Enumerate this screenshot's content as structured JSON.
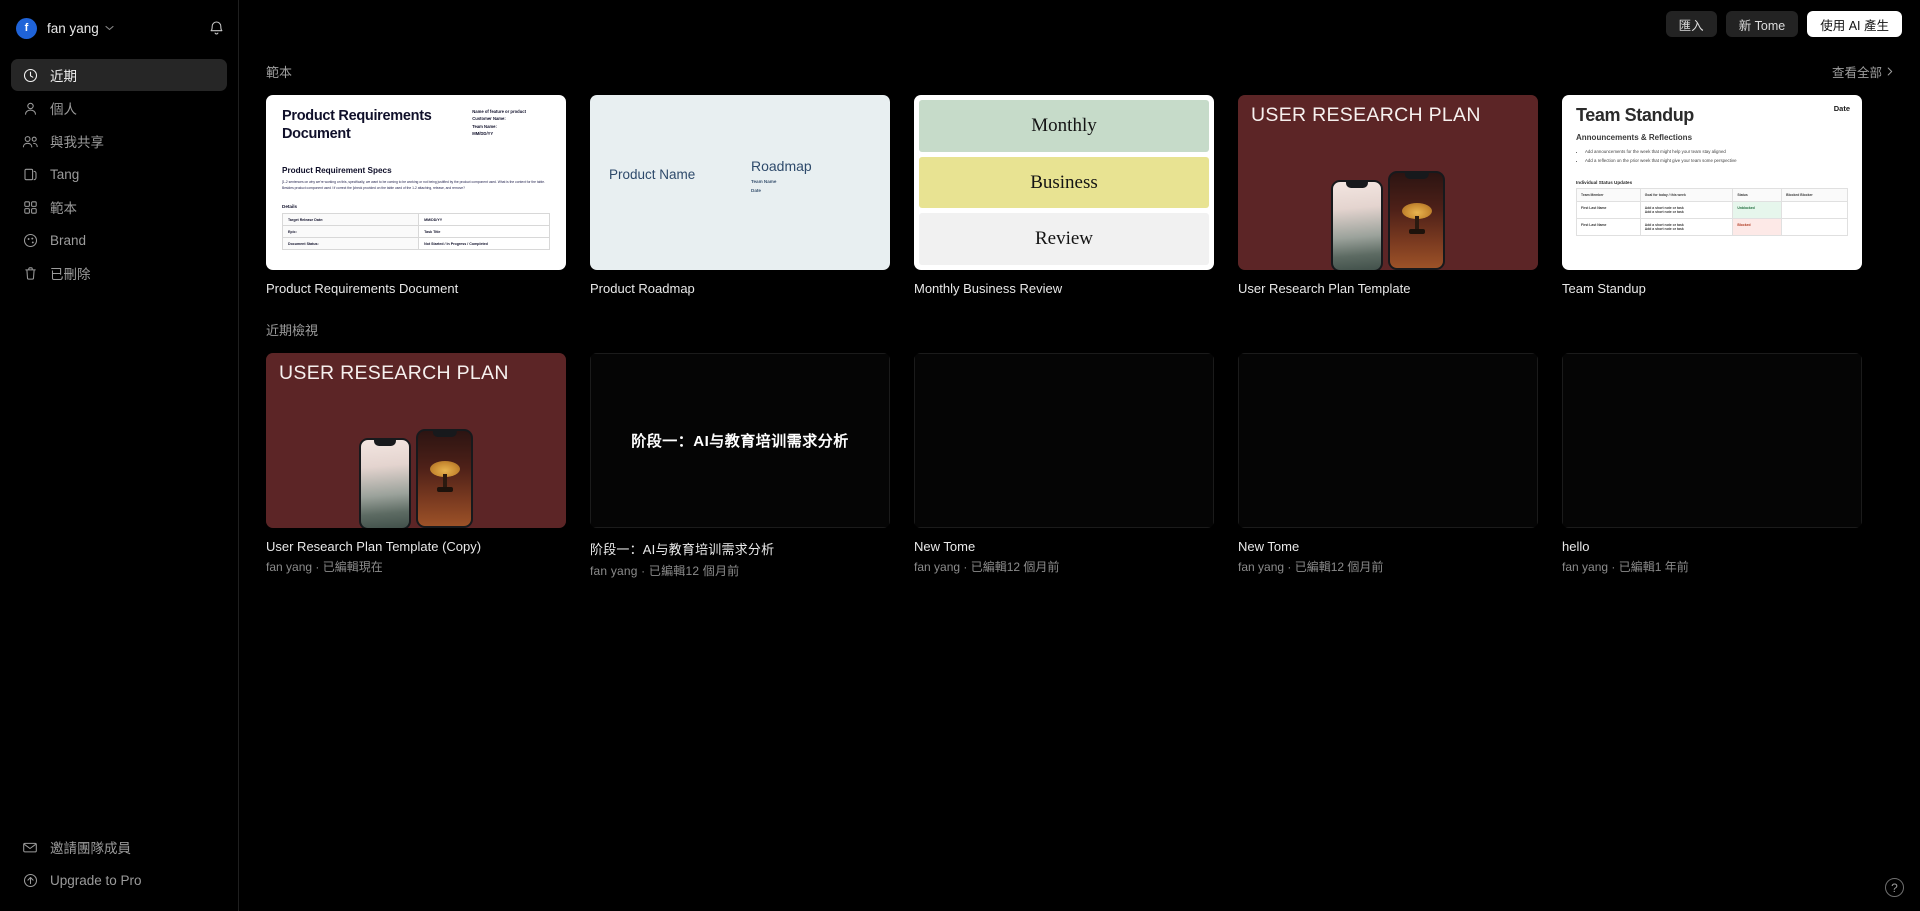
{
  "sidebar": {
    "user": {
      "initial": "f",
      "name": "fan yang"
    },
    "notifications_icon": "bell-icon",
    "items": [
      {
        "label": "近期",
        "icon": "clock-icon",
        "active": true
      },
      {
        "label": "個人",
        "icon": "person-icon",
        "active": false
      },
      {
        "label": "與我共享",
        "icon": "people-icon",
        "active": false
      },
      {
        "label": "Tang",
        "icon": "folder-icon",
        "active": false
      },
      {
        "label": "範本",
        "icon": "grid-icon",
        "active": false
      },
      {
        "label": "Brand",
        "icon": "palette-icon",
        "active": false
      },
      {
        "label": "已刪除",
        "icon": "trash-icon",
        "active": false
      }
    ],
    "bottom_items": [
      {
        "label": "邀請團隊成員",
        "icon": "mail-icon"
      },
      {
        "label": "Upgrade to Pro",
        "icon": "arrow-up-circle-icon"
      }
    ]
  },
  "topbar": {
    "import_label": "匯入",
    "new_tome_label": "新 Tome",
    "generate_ai_label": "使用 AI 產生"
  },
  "templates_section": {
    "title": "範本",
    "view_all_label": "查看全部",
    "view_all_icon": "chevron-right-icon",
    "cards": [
      {
        "title": "Product Requirements Document",
        "thumb": {
          "kind": "prd",
          "heading": "Product Requirements\nDocument",
          "meta": [
            "Name of feature or product",
            "Customer Name:",
            "Team Name:",
            "MM/DD/YY"
          ],
          "sub_heading": "Product Requirement Specs",
          "body": "[1-2 sentences on why we're working on this, specifically, we want to be coming to be working or not being justified by the product component used. What is the context for the table. Besides product component used / if correct the [check provided on the table used of the 1-2 attaching, release, and remove?",
          "details_label": "Details",
          "rows": [
            [
              "Target Release Date:",
              "MM/DD/YY"
            ],
            [
              "Epic:",
              "Task Title"
            ],
            [
              "Document Status:",
              "Not Started / In Progress / Completed"
            ]
          ]
        }
      },
      {
        "title": "Product Roadmap",
        "thumb": {
          "kind": "roadmap",
          "product_name": "Product Name",
          "roadmap": "Roadmap",
          "team_name": "Team Name",
          "date": "Date"
        }
      },
      {
        "title": "Monthly Business Review",
        "thumb": {
          "kind": "mbr",
          "bands": [
            "Monthly",
            "Business",
            "Review"
          ]
        }
      },
      {
        "title": "User Research Plan Template",
        "thumb": {
          "kind": "urp",
          "heading": "USER RESEARCH PLAN"
        }
      },
      {
        "title": "Team Standup",
        "thumb": {
          "kind": "standup",
          "date_label": "Date",
          "heading": "Team Standup",
          "sub_heading": "Announcements & Reflections",
          "bullets": [
            "Add announcements for the week that might help your team stay aligned",
            "Add a reflection on the prior week that might give your team some perspective"
          ],
          "table_label": "Individual Status Updates",
          "columns": [
            "Team Member",
            "Goal for today / this week",
            "Status",
            "Blocked Blocker"
          ],
          "rows": [
            {
              "member": "First Last Name",
              "goal": "Add a short note or task\nAdd a short note or task",
              "status": "Unblocked",
              "status_color": "green",
              "next": ""
            },
            {
              "member": "First Last Name",
              "goal": "Add a short note or task\nAdd a short note or task",
              "status": "Blocked",
              "status_color": "red",
              "next": ""
            }
          ]
        }
      }
    ]
  },
  "recents_section": {
    "title": "近期檢視",
    "cards": [
      {
        "title": "User Research Plan Template (Copy)",
        "subtitle": "fan yang · 已編輯現在",
        "thumb": {
          "kind": "urp",
          "heading": "USER RESEARCH PLAN"
        }
      },
      {
        "title": "阶段一：AI与教育培训需求分析",
        "subtitle": "fan yang · 已編輯12 個月前",
        "thumb": {
          "kind": "dark",
          "heading": "阶段一：AI与教育培训需求分析"
        }
      },
      {
        "title": "New Tome",
        "subtitle": "fan yang · 已編輯12 個月前",
        "thumb": {
          "kind": "dark",
          "heading": ""
        }
      },
      {
        "title": "New Tome",
        "subtitle": "fan yang · 已編輯12 個月前",
        "thumb": {
          "kind": "dark",
          "heading": ""
        }
      },
      {
        "title": "hello",
        "subtitle": "fan yang · 已編輯1 年前",
        "thumb": {
          "kind": "dark",
          "heading": ""
        }
      }
    ]
  },
  "help": {
    "icon": "question-mark-icon",
    "label": "?"
  },
  "colors": {
    "accent_avatar": "#1f63d8",
    "active_nav_bg": "#262626",
    "urp_bg": "#5c2526",
    "mbr_green": "#c6dbc9",
    "mbr_yellow": "#e8e392"
  }
}
